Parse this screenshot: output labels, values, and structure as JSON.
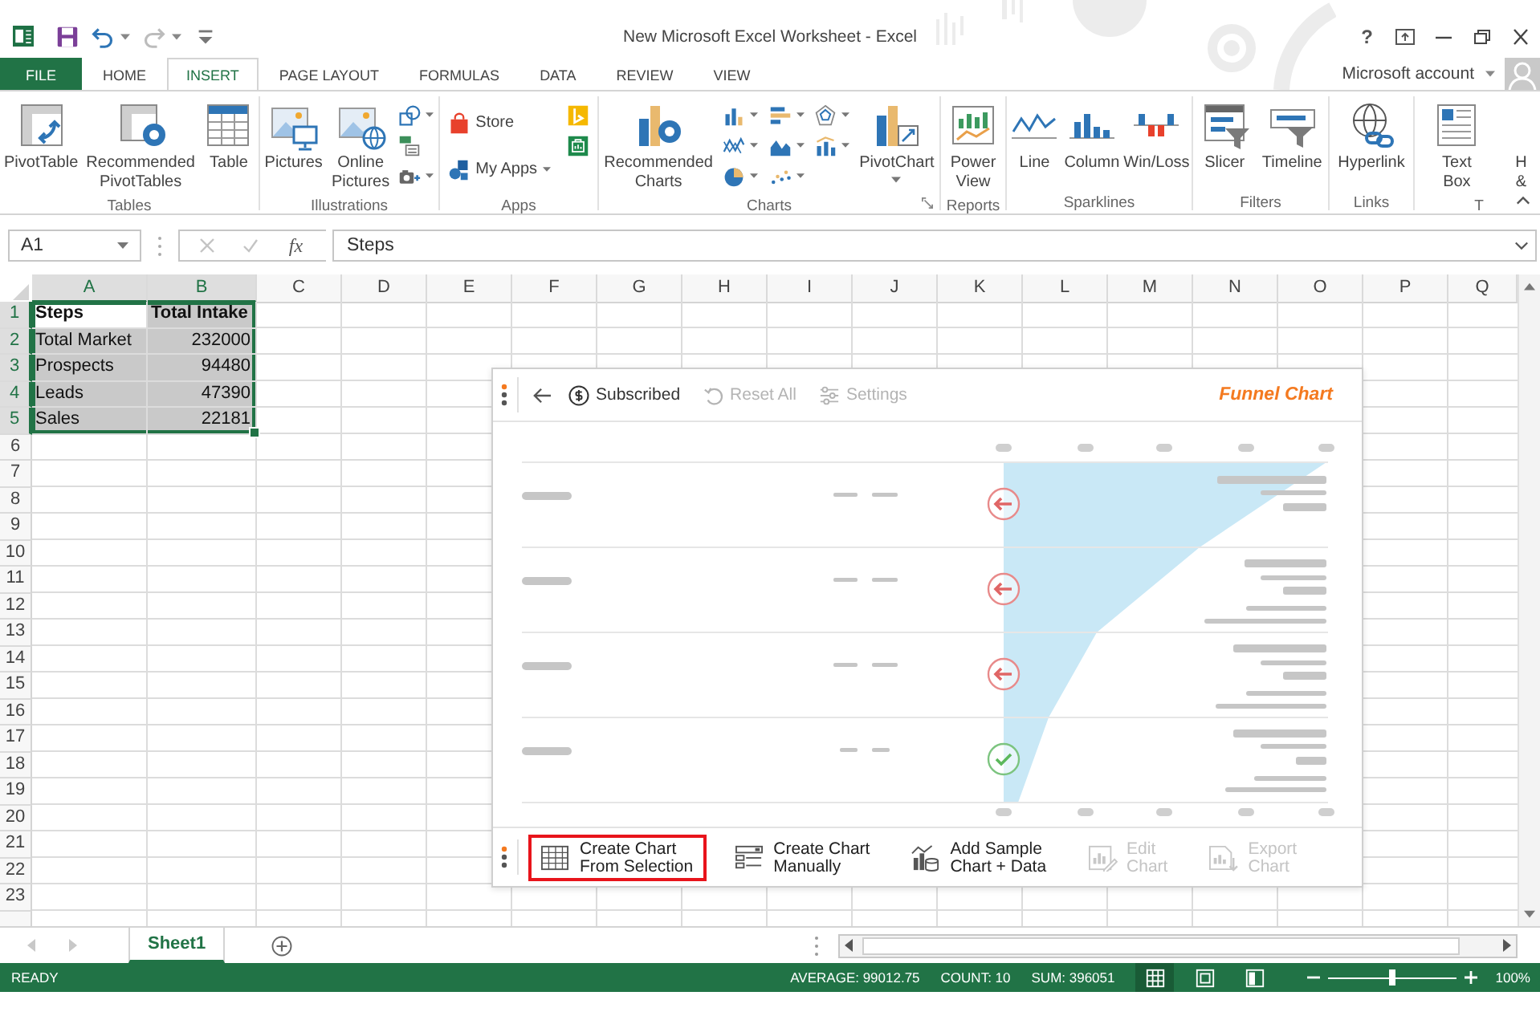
{
  "title_bar": {
    "title": "New Microsoft Excel Worksheet - Excel",
    "help": "?",
    "quick_access": [
      {
        "disabled": false,
        "dropdown": false
      },
      {
        "disabled": false,
        "dropdown": true
      },
      {
        "disabled": true,
        "dropdown": true
      },
      {
        "disabled": false,
        "dropdown": false
      }
    ]
  },
  "tabs": [
    {
      "label": "FILE",
      "kind": "file",
      "selected": false
    },
    {
      "label": "HOME",
      "kind": "tab",
      "selected": false
    },
    {
      "label": "INSERT",
      "kind": "tab",
      "selected": true
    },
    {
      "label": "PAGE LAYOUT",
      "kind": "tab",
      "selected": false
    },
    {
      "label": "FORMULAS",
      "kind": "tab",
      "selected": false
    },
    {
      "label": "DATA",
      "kind": "tab",
      "selected": false
    },
    {
      "label": "REVIEW",
      "kind": "tab",
      "selected": false
    },
    {
      "label": "VIEW",
      "kind": "tab",
      "selected": false
    }
  ],
  "account": {
    "label": "Microsoft account"
  },
  "ribbon": {
    "groups": [
      {
        "label": "Tables",
        "launcher": false,
        "items": [
          {
            "kind": "large",
            "label": "PivotTable",
            "dropdown": false
          },
          {
            "kind": "large",
            "label": "Recommended PivotTables",
            "dropdown": false
          },
          {
            "kind": "large",
            "label": "Table",
            "dropdown": false
          }
        ]
      },
      {
        "label": "Illustrations",
        "launcher": false,
        "items": [
          {
            "kind": "large",
            "label": "Pictures",
            "dropdown": false
          },
          {
            "kind": "large",
            "label": "Online Pictures",
            "dropdown": false
          },
          {
            "kind": "stack",
            "buttons": [
              {
                "dropdown": true
              },
              {
                "dropdown": false
              },
              {
                "dropdown": true
              }
            ]
          }
        ]
      },
      {
        "label": "Apps",
        "launcher": false,
        "items": [
          {
            "kind": "stack",
            "buttons": [
              {
                "label": "Store",
                "dropdown": false
              },
              {
                "label": "My Apps",
                "dropdown": true
              }
            ]
          },
          {
            "kind": "stack",
            "buttons": [
              {
                "dropdown": false
              },
              {
                "dropdown": false
              }
            ]
          }
        ]
      },
      {
        "label": "Charts",
        "launcher": true,
        "items": [
          {
            "kind": "large",
            "label": "Recommended Charts",
            "dropdown": false
          },
          {
            "kind": "stack",
            "buttons": [
              {
                "dropdown": true
              },
              {
                "dropdown": true
              },
              {
                "dropdown": true
              }
            ]
          },
          {
            "kind": "stack",
            "buttons": [
              {
                "dropdown": true
              },
              {
                "dropdown": true
              },
              {
                "dropdown": true
              }
            ]
          },
          {
            "kind": "stack",
            "buttons": [
              {
                "dropdown": true
              },
              {
                "dropdown": true
              }
            ]
          },
          {
            "kind": "large",
            "label": "PivotChart",
            "dropdown": true
          }
        ]
      },
      {
        "label": "Reports",
        "launcher": false,
        "items": [
          {
            "kind": "large",
            "label": "Power View",
            "dropdown": false
          }
        ]
      },
      {
        "label": "Sparklines",
        "launcher": false,
        "items": [
          {
            "kind": "large",
            "label": "Line",
            "dropdown": false
          },
          {
            "kind": "large",
            "label": "Column",
            "dropdown": false
          },
          {
            "kind": "large",
            "label": "Win/Loss",
            "dropdown": false
          }
        ]
      },
      {
        "label": "Filters",
        "launcher": false,
        "items": [
          {
            "kind": "large",
            "label": "Slicer",
            "dropdown": false
          },
          {
            "kind": "large",
            "label": "Timeline",
            "dropdown": false
          }
        ]
      },
      {
        "label": "Links",
        "launcher": false,
        "items": [
          {
            "kind": "large",
            "label": "Hyperlink",
            "dropdown": false
          }
        ]
      },
      {
        "label": "T",
        "launcher": false,
        "items": [
          {
            "kind": "large",
            "label": "Text Box",
            "dropdown": false
          },
          {
            "kind": "large",
            "label": "H &",
            "dropdown": false
          }
        ]
      }
    ]
  },
  "formula_bar": {
    "name_box": "A1",
    "function_button": "fx",
    "value": "Steps"
  },
  "sheet": {
    "columns": [
      {
        "label": "A",
        "selected": true
      },
      {
        "label": "B",
        "selected": true
      },
      {
        "label": "C",
        "selected": false
      },
      {
        "label": "D",
        "selected": false
      },
      {
        "label": "E",
        "selected": false
      },
      {
        "label": "F",
        "selected": false
      },
      {
        "label": "G",
        "selected": false
      },
      {
        "label": "H",
        "selected": false
      },
      {
        "label": "I",
        "selected": false
      },
      {
        "label": "J",
        "selected": false
      },
      {
        "label": "K",
        "selected": false
      },
      {
        "label": "L",
        "selected": false
      },
      {
        "label": "M",
        "selected": false
      },
      {
        "label": "N",
        "selected": false
      },
      {
        "label": "O",
        "selected": false
      },
      {
        "label": "P",
        "selected": false
      },
      {
        "label": "Q",
        "selected": false
      }
    ],
    "rows": [
      {
        "label": "1",
        "selected": true,
        "cells": [
          {
            "value": "Steps",
            "kind": "text",
            "bold": true,
            "selected": true,
            "active": true
          },
          {
            "value": "Total Intake",
            "kind": "text",
            "bold": true,
            "selected": true,
            "active": false
          }
        ]
      },
      {
        "label": "2",
        "selected": true,
        "cells": [
          {
            "value": "Total Market",
            "kind": "text",
            "bold": false,
            "selected": true,
            "active": false
          },
          {
            "value": "232000",
            "kind": "number",
            "bold": false,
            "selected": true,
            "active": false
          }
        ]
      },
      {
        "label": "3",
        "selected": true,
        "cells": [
          {
            "value": "Prospects",
            "kind": "text",
            "bold": false,
            "selected": true,
            "active": false
          },
          {
            "value": "94480",
            "kind": "number",
            "bold": false,
            "selected": true,
            "active": false
          }
        ]
      },
      {
        "label": "4",
        "selected": true,
        "cells": [
          {
            "value": "Leads",
            "kind": "text",
            "bold": false,
            "selected": true,
            "active": false
          },
          {
            "value": "47390",
            "kind": "number",
            "bold": false,
            "selected": true,
            "active": false
          }
        ]
      },
      {
        "label": "5",
        "selected": true,
        "cells": [
          {
            "value": "Sales",
            "kind": "text",
            "bold": false,
            "selected": true,
            "active": false
          },
          {
            "value": "22181",
            "kind": "number",
            "bold": false,
            "selected": true,
            "active": false
          }
        ]
      },
      {
        "label": "6",
        "selected": false
      },
      {
        "label": "7",
        "selected": false
      },
      {
        "label": "8",
        "selected": false
      },
      {
        "label": "9",
        "selected": false
      },
      {
        "label": "10",
        "selected": false
      },
      {
        "label": "11",
        "selected": false
      },
      {
        "label": "12",
        "selected": false
      },
      {
        "label": "13",
        "selected": false
      },
      {
        "label": "14",
        "selected": false
      },
      {
        "label": "15",
        "selected": false
      },
      {
        "label": "16",
        "selected": false
      },
      {
        "label": "17",
        "selected": false
      },
      {
        "label": "18",
        "selected": false
      },
      {
        "label": "19",
        "selected": false
      },
      {
        "label": "20",
        "selected": false
      },
      {
        "label": "21",
        "selected": false
      },
      {
        "label": "22",
        "selected": false
      },
      {
        "label": "23",
        "selected": false
      }
    ]
  },
  "panel": {
    "title": "Funnel Chart",
    "toolbar": [
      {
        "label": "Subscribed",
        "disabled": false
      },
      {
        "label": "Reset All",
        "disabled": true
      },
      {
        "label": "Settings",
        "disabled": true
      }
    ],
    "preview": {
      "rows": [
        {
          "done": false
        },
        {
          "done": false
        },
        {
          "done": false
        },
        {
          "done": true
        }
      ]
    },
    "actions": [
      {
        "label": "Create Chart\nFrom Selection",
        "highlighted": true,
        "disabled": false
      },
      {
        "label": "Create Chart\nManually",
        "highlighted": false,
        "disabled": false
      },
      {
        "label": "Add Sample\nChart + Data",
        "highlighted": false,
        "disabled": false
      },
      {
        "label": "Edit\nChart",
        "highlighted": false,
        "disabled": true
      },
      {
        "label": "Export\nChart",
        "highlighted": false,
        "disabled": true
      }
    ]
  },
  "sheet_tabs": [
    {
      "label": "Sheet1",
      "selected": true
    }
  ],
  "status_bar": {
    "mode": "READY",
    "stats": [
      "AVERAGE: 99012.75",
      "COUNT: 10",
      "SUM: 396051"
    ],
    "views": [
      {
        "selected": true
      },
      {
        "selected": false
      },
      {
        "selected": false
      }
    ],
    "zoom": {
      "level": 0.5,
      "label": "100%"
    }
  }
}
